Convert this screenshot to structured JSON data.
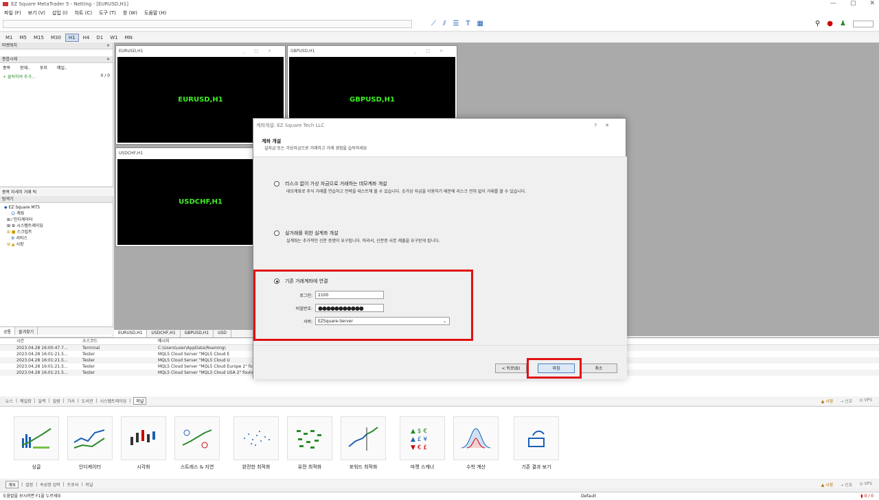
{
  "window": {
    "title": "EZ Square MetaTrader 5 - Netting - [EURUSD,H1]",
    "min": "—",
    "max": "▢",
    "close": "✕"
  },
  "menu": [
    "파일 (F)",
    "보기 (V)",
    "삽입 (I)",
    "차트 (C)",
    "도구 (T)",
    "창 (W)",
    "도움말 (H)"
  ],
  "timeframes": [
    "M1",
    "M5",
    "M15",
    "M30",
    "H1",
    "H4",
    "D1",
    "W1",
    "MN"
  ],
  "left": {
    "market_head": "마켓워치",
    "data_head": "종합시세",
    "cols": [
      "종목",
      "현재..",
      "포지",
      "매일.."
    ],
    "add_row": "+ 클릭하여 추가...",
    "count": "0 / 0",
    "mid_tabs": [
      "종목",
      "자세히",
      "거래",
      "틱"
    ],
    "nav_head": "탐색기",
    "tree": [
      "EZ Square MT5",
      "계좌",
      "인디케이터",
      "시스템트레이딩",
      "스크립트",
      "서비스",
      "시장"
    ],
    "bottom_tabs": [
      "공통",
      "즐겨찾기"
    ]
  },
  "charts": [
    {
      "title": "EURUSD,H1",
      "label": "EURUSD,H1"
    },
    {
      "title": "GBPUSD,H1",
      "label": "GBPUSD,H1"
    },
    {
      "title": "USDCHF,H1",
      "label": "USDCHF,H1"
    }
  ],
  "chart_tabs": [
    "EURUSD,H1",
    "USDCHF,H1",
    "GBPUSD,H1",
    "USD"
  ],
  "journal": {
    "cols": [
      "시간",
      "소스코드",
      "메시지"
    ],
    "rows": [
      [
        "2023.04.28 16:00:47.7...",
        "Terminal",
        "C:\\Users\\user\\AppData\\Roaming\\"
      ],
      [
        "2023.04.28 16:01:21.5...",
        "Tester",
        "MQL5 Cloud Server \"MQL5 Cloud E"
      ],
      [
        "2023.04.28 16:01:21.5...",
        "Tester",
        "MQL5 Cloud Server \"MQL5 Cloud U"
      ],
      [
        "2023.04.28 16:01:21.5...",
        "Tester",
        "MQL5 Cloud Server \"MQL5 Cloud Europe 2\" found"
      ],
      [
        "2023.04.28 16:01:21.5...",
        "Tester",
        "MQL5 Cloud Server \"MQL5 Cloud USA 2\" found"
      ]
    ],
    "tabs": [
      "뉴스",
      "메일함",
      "달력",
      "알람",
      "기사",
      "도서관",
      "시스템트레이딩",
      "저널"
    ],
    "market": "시장",
    "signal": "신호",
    "vps": "VPS"
  },
  "tools": [
    {
      "icon": "bar-line-chart-icon",
      "label": "싱글"
    },
    {
      "icon": "indicator-chart-icon",
      "label": "인디케이터"
    },
    {
      "icon": "candlestick-icon",
      "label": "시각화"
    },
    {
      "icon": "stress-chart-icon",
      "label": "스트레스 & 지연"
    },
    {
      "icon": "scatter-dots-icon",
      "label": "완전한 최적화"
    },
    {
      "icon": "genetic-grid-icon",
      "label": "유전 최적화"
    },
    {
      "icon": "forward-chart-icon",
      "label": "포워드 최적화"
    },
    {
      "icon": "currency-scanner-icon",
      "label": "마켓 스캐너"
    },
    {
      "icon": "bell-curve-icon",
      "label": "수학 계산"
    },
    {
      "icon": "open-results-icon",
      "label": "기존 결과 보기"
    }
  ],
  "bottom_tabs": [
    "개요",
    "설정",
    "속성정 입력",
    "트로셔",
    "저널"
  ],
  "status": {
    "help": "도움말을 보시려면 F1을 누르세요",
    "profile": "Default",
    "conn": "0 / 0"
  },
  "dialog": {
    "title": "계좌개설: EZ Square Tech LLC",
    "heading": "계좌 개설",
    "subheading": "실자금 또는 가상자금으로 거래하고 거래 경험을 습득하세요",
    "opt1": "리스크 없이 가상 자금으로 거래하는 데모계좌 개설",
    "opt1_desc": "데모계좌로 주식 거래를 연습하고 전략을 테스트해 볼 수 있습니다. 숫가상 자금을 이용하기 때문에 리스크 전혀 없이 거래를 할 수 있습니다.",
    "opt2": "실거래를 위한 실계좌 개설",
    "opt2_desc": "실계좌는 추가적인 신분 증명이 요구됩니다. 따라서, 신분증 사본 제출을 요구받게 됩니다.",
    "opt3": "기존 거래계좌에 연결",
    "login_label": "로그인:",
    "login_value": "2100",
    "password_label": "비밀번호:",
    "password_value": "●●●●●●●●●●●",
    "server_label": "서버:",
    "server_value": "EZSquare-Server",
    "back": "< 뒤로(B)",
    "finish": "마침",
    "cancel": "취소",
    "help": "?",
    "close": "✕"
  }
}
